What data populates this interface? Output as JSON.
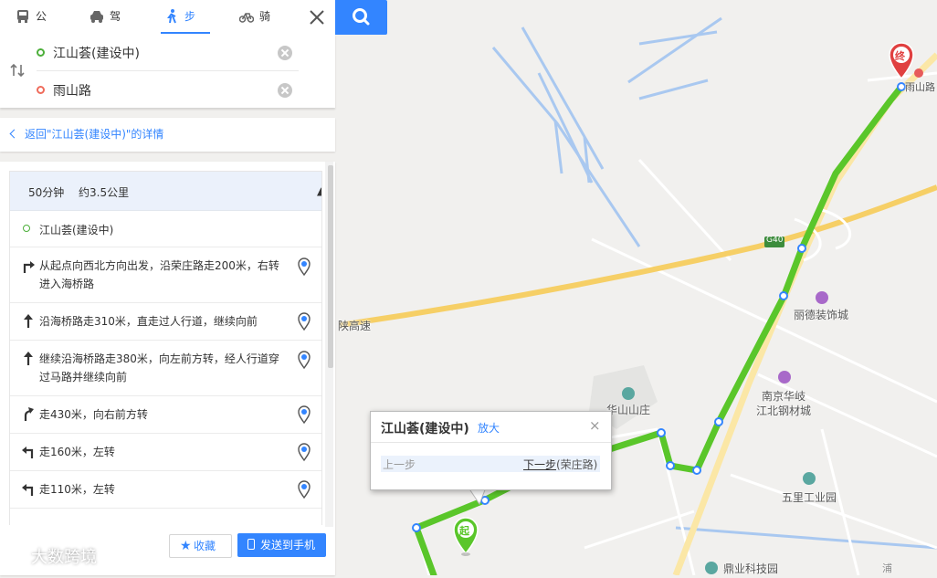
{
  "tabs": [
    {
      "label": "公交",
      "icon": "bus-icon"
    },
    {
      "label": "驾车",
      "icon": "car-icon"
    },
    {
      "label": "步行",
      "icon": "walk-icon",
      "active": true
    },
    {
      "label": "骑行",
      "icon": "bike-icon"
    }
  ],
  "route": {
    "start": "江山荟(建设中)",
    "end": "雨山路"
  },
  "back_link": "返回\"江山荟(建设中)\"的详情",
  "summary": {
    "duration": "50分钟",
    "distance": "约3.5公里"
  },
  "start_point": "江山荟(建设中)",
  "steps": [
    {
      "icon": "turn-right-icon",
      "text": "从起点向西北方向出发，沿荣庄路走200米，右转进入海桥路"
    },
    {
      "icon": "straight-icon",
      "text": "沿海桥路走310米，直走过人行道，继续向前"
    },
    {
      "icon": "straight-icon",
      "text": "继续沿海桥路走380米，向左前方转，经人行道穿过马路并继续向前"
    },
    {
      "icon": "slight-right-icon",
      "text": "走430米，向右前方转"
    },
    {
      "icon": "turn-left-icon",
      "text": "走160米，左转"
    },
    {
      "icon": "turn-left-icon",
      "text": "走110米，左转"
    }
  ],
  "buttons": {
    "favorite": "收藏",
    "send_to_phone": "发送到手机"
  },
  "watermark": "大数跨境",
  "popup": {
    "title": "江山荟(建设中)",
    "zoom": "放大",
    "close": "×",
    "prev": "上一步",
    "next": "下一步",
    "next_road": "(荣庄路)"
  },
  "map": {
    "labels": {
      "expressway": "陕高速",
      "highway_shield": "G40",
      "end_road": "雨山路",
      "poi_1": "丽德装饰城",
      "poi_2_line1": "南京华岐",
      "poi_2_line2": "江北钢材城",
      "poi_3": "华山山庄",
      "poi_4": "五里工业园",
      "poi_5": "鼎业科技园",
      "edge_char": "浦"
    },
    "start_marker": "起",
    "end_marker": "终",
    "colors": {
      "route": "#5ac62a",
      "accent": "#3385ff",
      "highway": "#f6cf66",
      "water": "#a9c8f0",
      "poi": "#a869c9"
    }
  }
}
